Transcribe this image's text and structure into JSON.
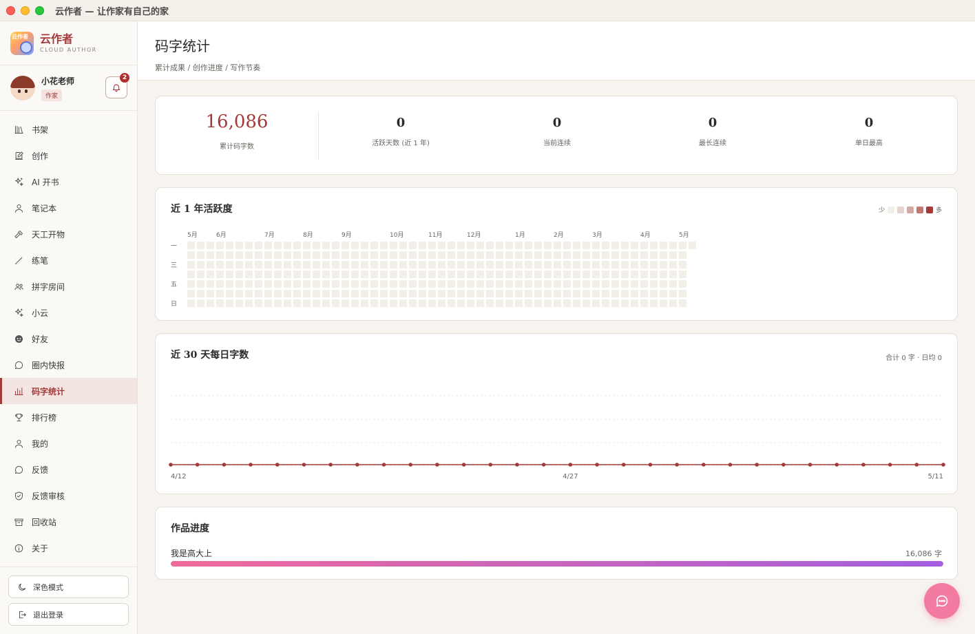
{
  "window": {
    "title": "云作者 — 让作家有自己的家"
  },
  "brand": {
    "name": "云作者",
    "subtitle": "CLOUD AUTHOR",
    "logo_text": "云作者"
  },
  "user": {
    "name": "小花老师",
    "role": "作家",
    "notifications": "2"
  },
  "nav": [
    {
      "id": "bookshelf",
      "label": "书架",
      "icon": "bookshelf-icon"
    },
    {
      "id": "create",
      "label": "创作",
      "icon": "edit-icon"
    },
    {
      "id": "ai-book",
      "label": "AI 开书",
      "icon": "sparkle-icon"
    },
    {
      "id": "notebook",
      "label": "笔记本",
      "icon": "user-icon"
    },
    {
      "id": "tiangong",
      "label": "天工开物",
      "icon": "hammer-icon"
    },
    {
      "id": "practice",
      "label": "练笔",
      "icon": "pen-icon"
    },
    {
      "id": "room",
      "label": "拼字房间",
      "icon": "group-icon"
    },
    {
      "id": "xiaoyun",
      "label": "小云",
      "icon": "sparkle-icon"
    },
    {
      "id": "friends",
      "label": "好友",
      "icon": "face-icon"
    },
    {
      "id": "news",
      "label": "圈内快报",
      "icon": "chat-icon"
    },
    {
      "id": "stats",
      "label": "码字统计",
      "icon": "bar-chart-icon",
      "active": true
    },
    {
      "id": "ranking",
      "label": "排行榜",
      "icon": "trophy-icon"
    },
    {
      "id": "mine",
      "label": "我的",
      "icon": "user-icon"
    },
    {
      "id": "feedback",
      "label": "反馈",
      "icon": "chat-icon"
    },
    {
      "id": "review",
      "label": "反馈审核",
      "icon": "shield-icon"
    },
    {
      "id": "trash",
      "label": "回收站",
      "icon": "archive-icon"
    },
    {
      "id": "about",
      "label": "关于",
      "icon": "info-icon"
    }
  ],
  "sidebar_bottom": {
    "dark_mode": "深色模式",
    "logout": "退出登录"
  },
  "page": {
    "title": "码字统计",
    "breadcrumb": "累计成果 / 创作进度 / 写作节奏"
  },
  "stats": {
    "total": {
      "value": "16,086",
      "label": "累计码字数"
    },
    "items": [
      {
        "value": "0",
        "label": "活跃天数 (近 1 年)"
      },
      {
        "value": "0",
        "label": "当前连续"
      },
      {
        "value": "0",
        "label": "最长连续"
      },
      {
        "value": "0",
        "label": "单日最高"
      }
    ]
  },
  "heatmap": {
    "title": "近 1 年活跃度",
    "legend_less": "少",
    "legend_more": "多",
    "legend_colors": [
      "#f2eee8",
      "#e6d3cd",
      "#d3a9a2",
      "#c07870",
      "#a33a3a"
    ],
    "months": [
      {
        "label": "5月",
        "week": 0
      },
      {
        "label": "6月",
        "week": 3
      },
      {
        "label": "7月",
        "week": 8
      },
      {
        "label": "8月",
        "week": 12
      },
      {
        "label": "9月",
        "week": 16
      },
      {
        "label": "10月",
        "week": 21
      },
      {
        "label": "11月",
        "week": 25
      },
      {
        "label": "12月",
        "week": 29
      },
      {
        "label": "1月",
        "week": 34
      },
      {
        "label": "2月",
        "week": 38
      },
      {
        "label": "3月",
        "week": 42
      },
      {
        "label": "4月",
        "week": 47
      },
      {
        "label": "5月",
        "week": 51
      }
    ],
    "weekdays": [
      {
        "label": "一",
        "row": 0
      },
      {
        "label": "三",
        "row": 2
      },
      {
        "label": "五",
        "row": 4
      },
      {
        "label": "日",
        "row": 6
      }
    ],
    "weeks": 53,
    "last_week_days": 1
  },
  "daily": {
    "title": "近 30 天每日字数",
    "summary": "合计 0 字 · 日均 0",
    "x_labels": [
      "4/12",
      "4/27",
      "5/11"
    ]
  },
  "chart_data": {
    "type": "line",
    "title": "近 30 天每日字数",
    "x": [
      "4/12",
      "4/13",
      "4/14",
      "4/15",
      "4/16",
      "4/17",
      "4/18",
      "4/19",
      "4/20",
      "4/21",
      "4/22",
      "4/23",
      "4/24",
      "4/25",
      "4/26",
      "4/27",
      "4/28",
      "4/29",
      "4/30",
      "5/1",
      "5/2",
      "5/3",
      "5/4",
      "5/5",
      "5/6",
      "5/7",
      "5/8",
      "5/9",
      "5/10",
      "5/11"
    ],
    "series": [
      {
        "values": [
          0,
          0,
          0,
          0,
          0,
          0,
          0,
          0,
          0,
          0,
          0,
          0,
          0,
          0,
          0,
          0,
          0,
          0,
          0,
          0,
          0,
          0,
          0,
          0,
          0,
          0,
          0,
          0,
          0,
          0
        ]
      }
    ],
    "xtick_labels": [
      "4/12",
      "4/27",
      "5/11"
    ],
    "color": "#a33a3a",
    "grid": true
  },
  "progress": {
    "title": "作品进度",
    "works": [
      {
        "name": "我是高大上",
        "count": "16,086 字",
        "fraction": 1.0
      }
    ]
  }
}
